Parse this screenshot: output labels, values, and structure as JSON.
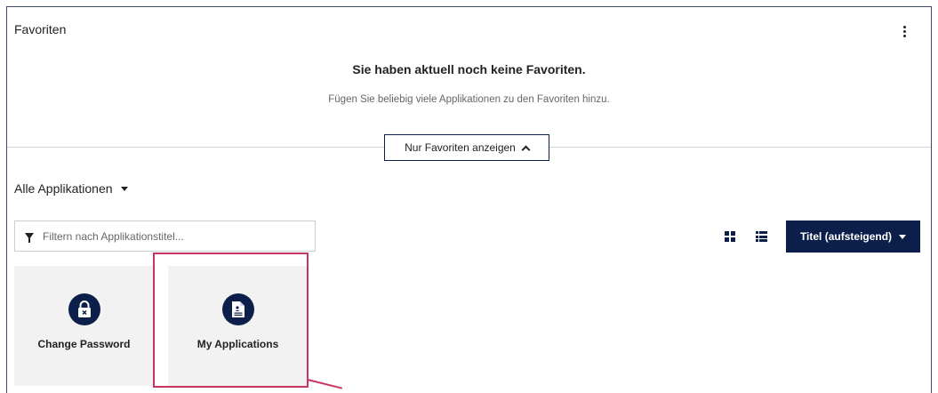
{
  "favorites": {
    "header": "Favoriten",
    "empty_title": "Sie haben aktuell noch keine Favoriten.",
    "empty_subtitle": "Fügen Sie beliebig viele Applikationen zu den Favoriten hinzu.",
    "toggle_label": "Nur Favoriten anzeigen"
  },
  "applications": {
    "section_title": "Alle Applikationen",
    "filter_placeholder": "Filtern nach Applikationstitel...",
    "sort_label": "Titel (aufsteigend)",
    "tiles": [
      {
        "label": "Change Password",
        "icon": "lock-icon"
      },
      {
        "label": "My Applications",
        "icon": "document-icon"
      }
    ]
  },
  "colors": {
    "brand_navy": "#0c1f4a",
    "highlight": "#c7365f",
    "tile_bg": "#f2f2f2"
  }
}
